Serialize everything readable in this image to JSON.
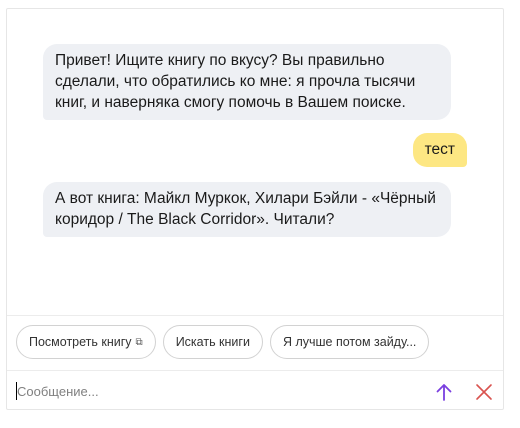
{
  "messages": [
    {
      "role": "bot",
      "text": "Привет! Ищите книгу по вкусу? Вы правильно сделали, что обратились ко мне: я прочла тысячи книг, и наверняка смогу помочь в Вашем поиске."
    },
    {
      "role": "user",
      "text": "тест"
    },
    {
      "role": "bot",
      "text": "А вот книга: Майкл Муркок, Хилари Бэйли - «Чёрный коридор / The Black Corridor». Читали?"
    }
  ],
  "suggestions": [
    {
      "label": "Посмотреть книгу",
      "icon": "external-link-icon"
    },
    {
      "label": "Искать книги"
    },
    {
      "label": "Я лучше потом зайду..."
    }
  ],
  "composer": {
    "placeholder": "Сообщение...",
    "value": "",
    "send_icon": "arrow-up-icon",
    "close_icon": "close-icon"
  },
  "colors": {
    "bot_bubble": "#eef0f4",
    "user_bubble": "#fde783",
    "send_icon": "#7a3fe0",
    "close_icon": "#d9534f"
  }
}
